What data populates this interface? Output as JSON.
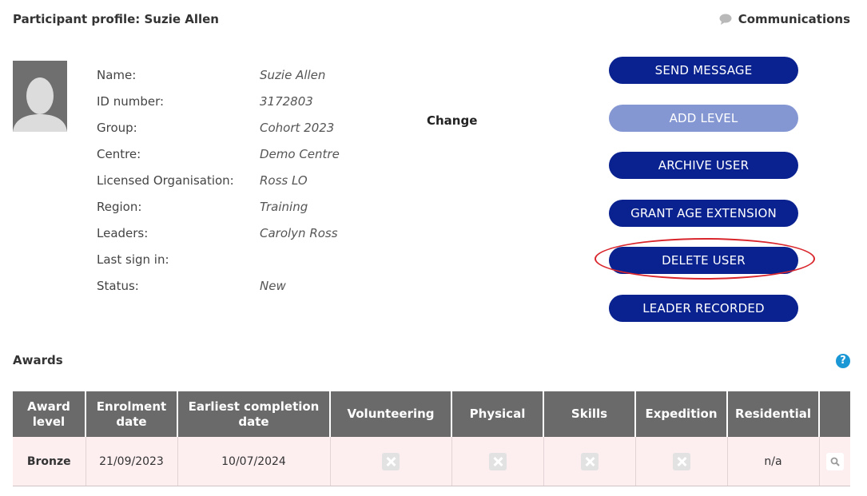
{
  "header": {
    "title": "Participant profile: Suzie Allen",
    "communications_label": "Communications",
    "communications_icon": "speech-bubble-icon"
  },
  "profile": {
    "avatar_icon": "default-avatar-icon",
    "fields": [
      {
        "label": "Name:",
        "value": "Suzie Allen"
      },
      {
        "label": "ID number:",
        "value": "3172803"
      },
      {
        "label": "Group:",
        "value": "Cohort 2023"
      },
      {
        "label": "Centre:",
        "value": "Demo Centre"
      },
      {
        "label": "Licensed Organisation:",
        "value": "Ross LO"
      },
      {
        "label": "Region:",
        "value": "Training"
      },
      {
        "label": "Leaders:",
        "value": "Carolyn Ross"
      },
      {
        "label": "Last sign in:",
        "value": ""
      },
      {
        "label": "Status:",
        "value": "New"
      }
    ],
    "change_label": "Change"
  },
  "actions": [
    {
      "label": "SEND MESSAGE",
      "enabled": true
    },
    {
      "label": "ADD LEVEL",
      "enabled": false
    },
    {
      "label": "ARCHIVE USER",
      "enabled": true
    },
    {
      "label": "GRANT AGE EXTENSION",
      "enabled": true
    },
    {
      "label": "DELETE USER",
      "enabled": true
    },
    {
      "label": "LEADER RECORDED",
      "enabled": true
    }
  ],
  "awards": {
    "title": "Awards",
    "help_icon": "question-circle-icon",
    "help_glyph": "?",
    "columns": [
      "Award level",
      "Enrolment date",
      "Earliest completion date",
      "Volunteering",
      "Physical",
      "Skills",
      "Expedition",
      "Residential",
      ""
    ],
    "rows": [
      {
        "level": "Bronze",
        "enrolment": "21/09/2023",
        "earliest": "10/07/2024",
        "volunteering": "not-complete-icon",
        "physical": "not-complete-icon",
        "skills": "not-complete-icon",
        "expedition": "not-complete-icon",
        "residential": "n/a",
        "view_icon": "magnifier-icon"
      }
    ]
  },
  "colors": {
    "button": "#0a2290",
    "button_disabled": "#8597d3",
    "table_header": "#6a6a6a",
    "row_background": "#fdeef0",
    "highlight_ring": "#d9262c",
    "help_icon": "#1a98d5"
  }
}
